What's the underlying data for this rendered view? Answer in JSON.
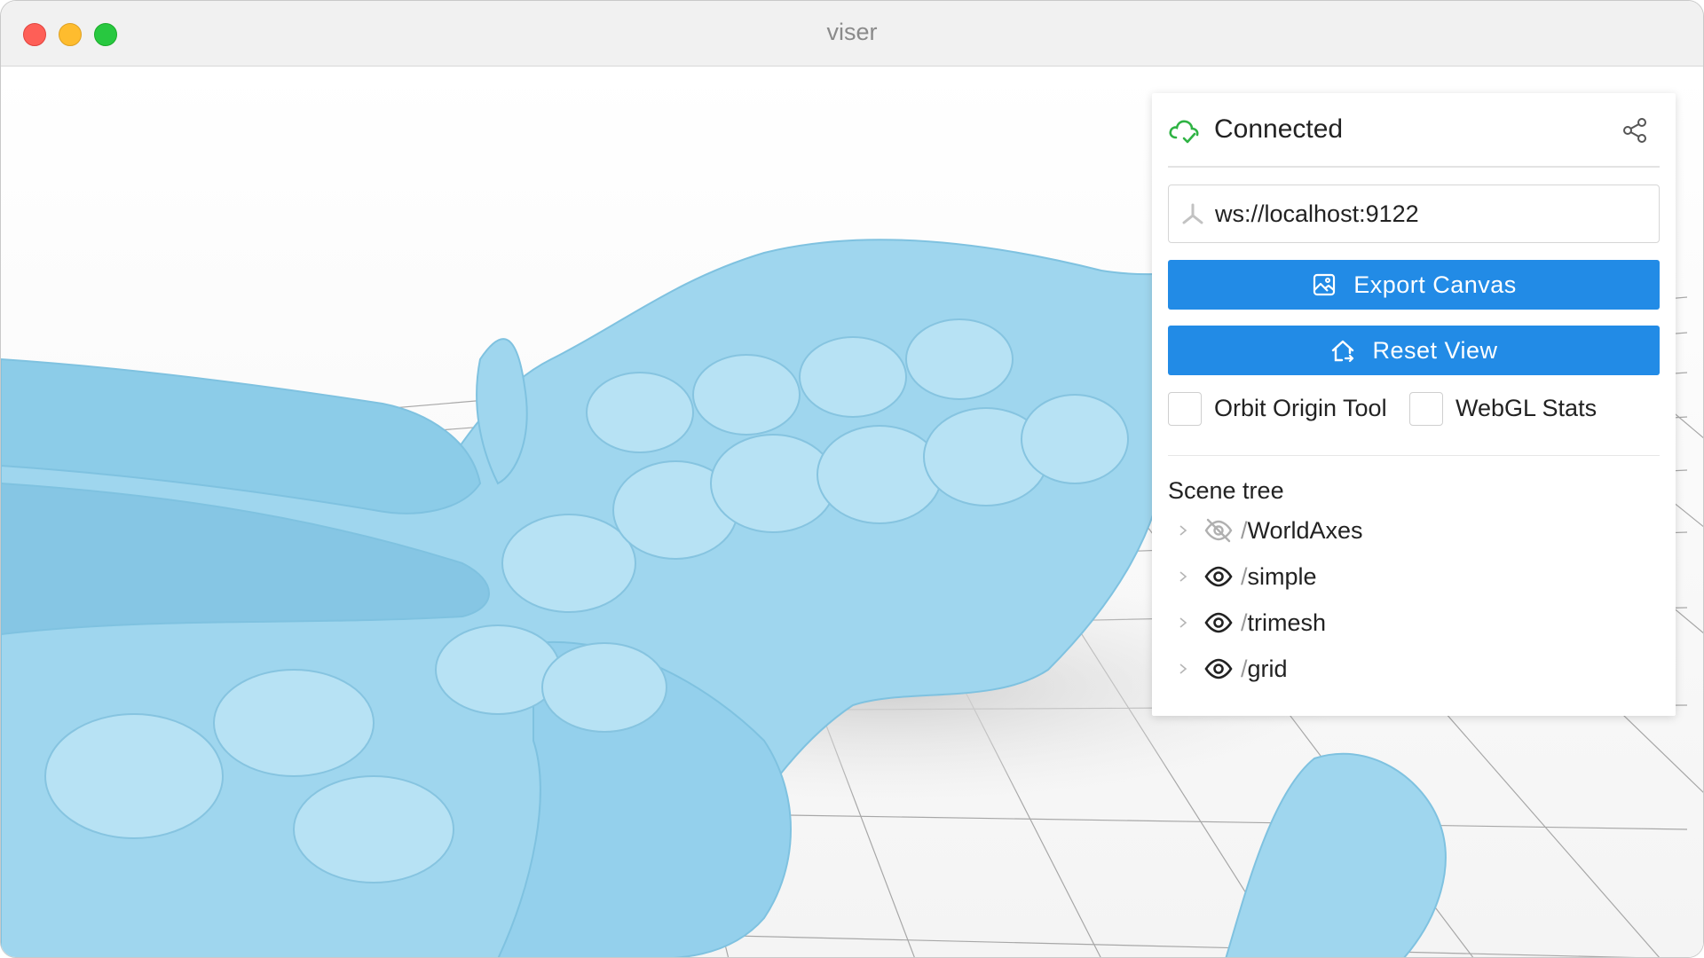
{
  "window": {
    "title": "viser"
  },
  "panel": {
    "status": "Connected",
    "server_url": "ws://localhost:9122",
    "buttons": {
      "export_canvas": "Export Canvas",
      "reset_view": "Reset View"
    },
    "checkboxes": {
      "orbit_origin_tool": "Orbit Origin Tool",
      "webgl_stats": "WebGL Stats"
    },
    "scene_tree": {
      "title": "Scene tree",
      "items": [
        {
          "label": "WorldAxes",
          "visible": false
        },
        {
          "label": "simple",
          "visible": true
        },
        {
          "label": "trimesh",
          "visible": true
        },
        {
          "label": "grid",
          "visible": true
        }
      ]
    }
  },
  "colors": {
    "accent_button": "#228be6",
    "connected_green": "#2fb344",
    "mesh_blue": "#9fd6ee"
  },
  "icons": {
    "status": "cloud-check-icon",
    "share": "share-icon",
    "url": "tripod-icon",
    "export": "photo-icon",
    "reset": "home-icon",
    "visible": "eye-icon",
    "hidden": "eye-off-icon",
    "caret": "caret-right-icon"
  }
}
